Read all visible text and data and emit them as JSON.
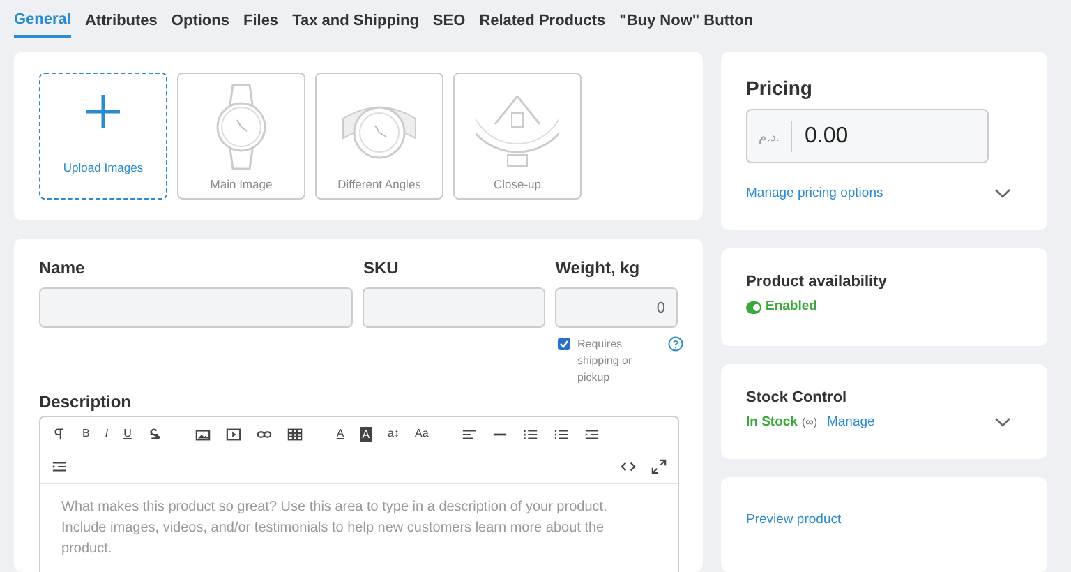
{
  "tabs": [
    {
      "label": "General",
      "selected": true
    },
    {
      "label": "Attributes",
      "selected": false
    },
    {
      "label": "Options",
      "selected": false
    },
    {
      "label": "Files",
      "selected": false
    },
    {
      "label": "Tax and Shipping",
      "selected": false
    },
    {
      "label": "SEO",
      "selected": false
    },
    {
      "label": "Related Products",
      "selected": false
    },
    {
      "label": "\"Buy Now\" Button",
      "selected": false
    }
  ],
  "media": [
    {
      "kind": "upload",
      "label": "Upload Images"
    },
    {
      "kind": "front",
      "label": "Main Image"
    },
    {
      "kind": "angle",
      "label": "Different Angles"
    },
    {
      "kind": "closeup",
      "label": "Close-up"
    }
  ],
  "fields": [
    {
      "label": "Name"
    },
    {
      "label": "SKU"
    },
    {
      "label": "Weight, kg",
      "value": "0"
    }
  ],
  "shipping": {
    "label": "Requires shipping or pickup",
    "checked": true
  },
  "description": {
    "label": "Description",
    "placeholder": "What makes this product so great? Use this area to type in a description of your product. Include images, videos, and/or testimonials to help new customers learn more about the product."
  },
  "toolbar": [
    {
      "kind": "paragraph"
    },
    {
      "kind": "text",
      "label": "B"
    },
    {
      "kind": "italic",
      "label": "I"
    },
    {
      "kind": "underline",
      "label": "U"
    },
    {
      "kind": "strike"
    },
    {
      "kind": "gap"
    },
    {
      "kind": "image"
    },
    {
      "kind": "video"
    },
    {
      "kind": "link"
    },
    {
      "kind": "table"
    },
    {
      "kind": "gap"
    },
    {
      "kind": "fontcolor",
      "label": "A"
    },
    {
      "kind": "highlight",
      "label": "A"
    },
    {
      "kind": "text",
      "label": "a↕"
    },
    {
      "kind": "text",
      "label": "Aa"
    },
    {
      "kind": "gap"
    },
    {
      "kind": "align"
    },
    {
      "kind": "hr"
    },
    {
      "kind": "list"
    },
    {
      "kind": "list"
    },
    {
      "kind": "indent"
    },
    {
      "kind": "break"
    },
    {
      "kind": "indent"
    },
    {
      "kind": "spacer"
    },
    {
      "kind": "code"
    },
    {
      "kind": "fullscreen"
    }
  ],
  "pricing": {
    "title": "Pricing",
    "currency": "د.م.",
    "value": "0.00",
    "link": "Manage pricing options"
  },
  "availability": {
    "title": "Product availability",
    "status": "Enabled",
    "on": true
  },
  "stock": {
    "title": "Stock Control",
    "status": "In Stock",
    "count": "(∞)",
    "link": "Manage"
  },
  "preview": {
    "link": "Preview product"
  }
}
